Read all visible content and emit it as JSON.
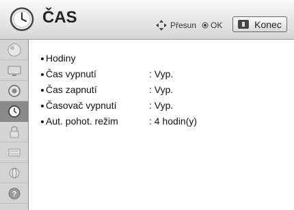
{
  "header": {
    "title": "ČAS",
    "nav_hint_move": "Přesun",
    "nav_hint_ok": "OK",
    "exit_label": "Konec"
  },
  "sidebar": {
    "items": [
      {
        "icon": "picture-icon",
        "active": false
      },
      {
        "icon": "screen-icon",
        "active": false
      },
      {
        "icon": "speaker-icon",
        "active": false
      },
      {
        "icon": "clock-icon",
        "active": true
      },
      {
        "icon": "lock-icon",
        "active": false
      },
      {
        "icon": "option-icon",
        "active": false
      },
      {
        "icon": "network-icon",
        "active": false
      },
      {
        "icon": "help-icon",
        "active": false
      }
    ]
  },
  "menu": {
    "items": [
      {
        "label": "Hodiny",
        "value": ""
      },
      {
        "label": "Čas vypnutí",
        "value": ": Vyp."
      },
      {
        "label": "Čas zapnutí",
        "value": ": Vyp."
      },
      {
        "label": "Časovač vypnutí",
        "value": ": Vyp."
      },
      {
        "label": "Aut. pohot. režim",
        "value": ": 4 hodin(y)"
      }
    ]
  }
}
